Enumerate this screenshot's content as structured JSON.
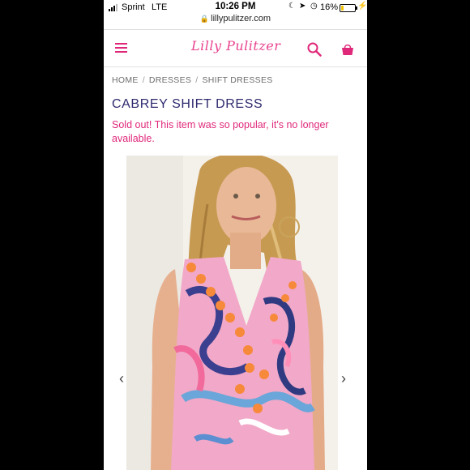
{
  "status_bar": {
    "carrier": "Sprint",
    "network": "LTE",
    "time": "10:26 PM",
    "battery_percent": "16%",
    "battery_level": 0.16,
    "url": "lillypulitzer.com"
  },
  "header": {
    "logo_text": "Lilly Pulitzer"
  },
  "breadcrumb": {
    "items": [
      "HOME",
      "DRESSES",
      "SHIFT DRESSES"
    ],
    "separator": "/"
  },
  "product": {
    "title": "CABREY SHIFT DRESS",
    "sold_out_message": "Sold out! This item was so popular, it's no longer available."
  },
  "colors": {
    "brand_pink": "#e0287a",
    "title_navy": "#2e2a6e"
  },
  "icons": {
    "menu": "hamburger-icon",
    "search": "search-icon",
    "bag": "shopping-bag-icon",
    "prev": "chevron-left-icon",
    "next": "chevron-right-icon"
  },
  "carousel": {
    "prev_glyph": "‹",
    "next_glyph": "›"
  }
}
